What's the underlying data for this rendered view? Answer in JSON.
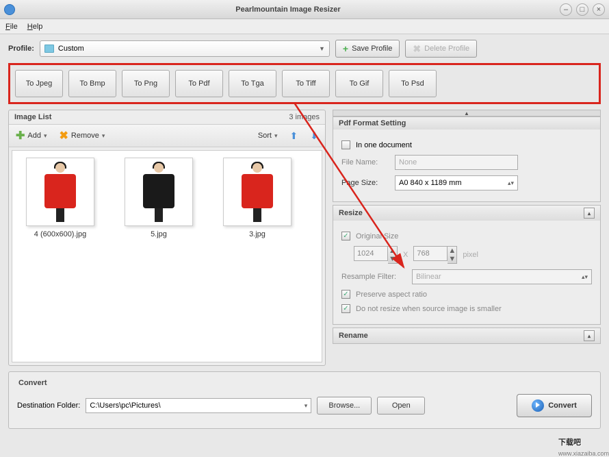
{
  "window": {
    "title": "Pearlmountain Image Resizer"
  },
  "menu": {
    "file": "File",
    "help": "Help"
  },
  "profile": {
    "label": "Profile:",
    "selected": "Custom",
    "save": "Save Profile",
    "delete": "Delete Profile"
  },
  "formats": [
    "To Jpeg",
    "To Bmp",
    "To Png",
    "To Pdf",
    "To Tga",
    "To Tiff",
    "To Gif",
    "To Psd"
  ],
  "imageList": {
    "title": "Image List",
    "count": "3 images",
    "add": "Add",
    "remove": "Remove",
    "sort": "Sort",
    "items": [
      {
        "name": "4 (600x600).jpg",
        "color": "#d9251d"
      },
      {
        "name": "5.jpg",
        "color": "#1a1a1a"
      },
      {
        "name": "3.jpg",
        "color": "#d9251d"
      }
    ]
  },
  "pdf": {
    "title": "Pdf Format Setting",
    "inOne": "In one document",
    "fileNameLabel": "File Name:",
    "fileName": "None",
    "pageSizeLabel": "Page Size:",
    "pageSize": "A0 840 x 1189 mm"
  },
  "resize": {
    "title": "Resize",
    "original": "Original Size",
    "width": "1024",
    "height": "768",
    "x": "X",
    "pixel": "pixel",
    "resampleLabel": "Resample Filter:",
    "resample": "Bilinear",
    "preserve": "Preserve aspect ratio",
    "noResize": "Do not resize when source image is smaller"
  },
  "rename": {
    "title": "Rename"
  },
  "convert": {
    "title": "Convert",
    "destLabel": "Destination Folder:",
    "destPath": "C:\\Users\\pc\\Pictures\\",
    "browse": "Browse...",
    "open": "Open",
    "convert": "Convert"
  },
  "watermark": {
    "text": "下载吧",
    "url": "www.xiazaiba.com"
  }
}
